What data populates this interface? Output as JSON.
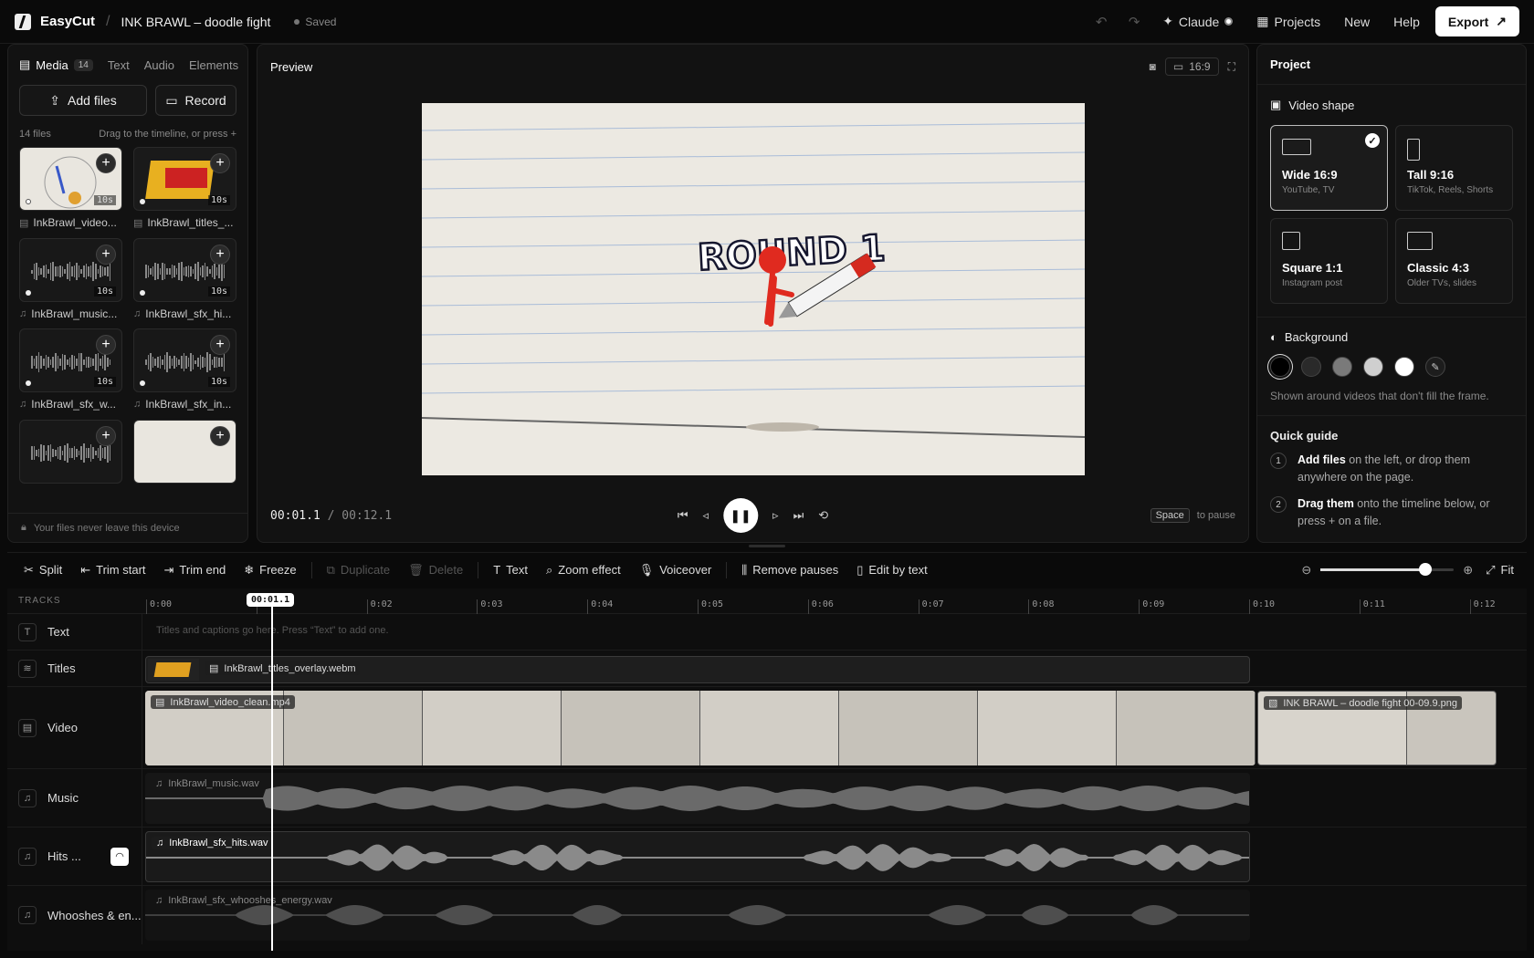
{
  "app": {
    "brand": "EasyCut",
    "project_name": "INK BRAWL – doodle fight",
    "status": "Saved"
  },
  "topbar": {
    "claude": "Claude",
    "projects": "Projects",
    "new": "New",
    "help": "Help",
    "export": "Export"
  },
  "left": {
    "tabs": [
      {
        "label": "Media",
        "count": "14"
      },
      {
        "label": "Text"
      },
      {
        "label": "Audio"
      },
      {
        "label": "Elements"
      }
    ],
    "add_files": "Add files",
    "record": "Record",
    "file_count": "14 files",
    "drag_hint": "Drag to the timeline, or press +",
    "files": [
      {
        "name": "InkBrawl_video...",
        "dur": "10s",
        "kind": "video"
      },
      {
        "name": "InkBrawl_titles_...",
        "dur": "10s",
        "kind": "video"
      },
      {
        "name": "InkBrawl_music...",
        "dur": "10s",
        "kind": "audio"
      },
      {
        "name": "InkBrawl_sfx_hi...",
        "dur": "10s",
        "kind": "audio"
      },
      {
        "name": "InkBrawl_sfx_w...",
        "dur": "10s",
        "kind": "audio"
      },
      {
        "name": "InkBrawl_sfx_in...",
        "dur": "10s",
        "kind": "audio"
      }
    ],
    "footer": "Your files never leave this device"
  },
  "preview": {
    "title": "Preview",
    "ratio": "16:9",
    "overlay_text": "ROUND 1",
    "current": "00:01.1",
    "total": "00:12.1",
    "hint_key": "Space",
    "hint_text": "to pause"
  },
  "right": {
    "title": "Project",
    "video_shape_heading": "Video shape",
    "shapes": [
      {
        "name": "Wide 16:9",
        "sub": "YouTube, TV",
        "selected": true
      },
      {
        "name": "Tall 9:16",
        "sub": "TikTok, Reels, Shorts"
      },
      {
        "name": "Square 1:1",
        "sub": "Instagram post"
      },
      {
        "name": "Classic 4:3",
        "sub": "Older TVs, slides"
      }
    ],
    "background_heading": "Background",
    "swatch_colors": [
      "#000000",
      "#2a2a2a",
      "#7a7a7a",
      "#cfcfcf",
      "#ffffff"
    ],
    "background_note": "Shown around videos that don't fill the frame.",
    "guide_heading": "Quick guide",
    "steps": [
      {
        "n": "1",
        "bold": "Add files",
        "rest": " on the left, or drop them anywhere on the page."
      },
      {
        "n": "2",
        "bold": "Drag them",
        "rest": " onto the timeline below, or press + on a file."
      }
    ]
  },
  "toolbar": {
    "split": "Split",
    "trim_start": "Trim start",
    "trim_end": "Trim end",
    "freeze": "Freeze",
    "duplicate": "Duplicate",
    "delete": "Delete",
    "text": "Text",
    "zoom_effect": "Zoom effect",
    "voiceover": "Voiceover",
    "remove_pauses": "Remove pauses",
    "edit_by_text": "Edit by text",
    "fit": "Fit",
    "zoom_level": 0.78
  },
  "timeline": {
    "tracks_label": "TRACKS",
    "ticks": [
      "0:00",
      "0:01",
      "0:02",
      "0:03",
      "0:04",
      "0:05",
      "0:06",
      "0:07",
      "0:08",
      "0:09",
      "0:10",
      "0:11",
      "0:12"
    ],
    "playhead": "00:01.1",
    "lanes": [
      {
        "name": "Text",
        "placeholder": "Titles and captions go here. Press “Text” to add one."
      },
      {
        "name": "Titles",
        "clip": "InkBrawl_titles_overlay.webm"
      },
      {
        "name": "Video",
        "clip": "InkBrawl_video_clean.mp4",
        "clip2": "INK BRAWL – doodle fight 00-09.9.png"
      },
      {
        "name": "Music",
        "clip": "InkBrawl_music.wav"
      },
      {
        "name": "Hits ...",
        "clip": "InkBrawl_sfx_hits.wav"
      },
      {
        "name": "Whooshes & en...",
        "clip": "InkBrawl_sfx_whooshes_energy.wav"
      }
    ]
  }
}
